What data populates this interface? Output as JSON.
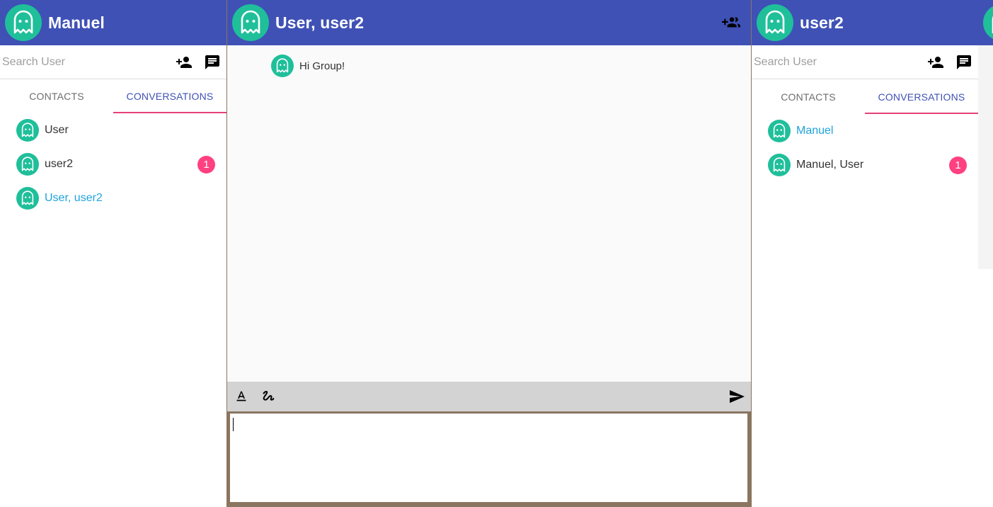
{
  "left": {
    "user_name": "Manuel",
    "search_placeholder": "Search User",
    "tabs": [
      "CONTACTS",
      "CONVERSATIONS"
    ],
    "active_tab": "CONVERSATIONS",
    "conversations": [
      {
        "name": "User",
        "badge": ""
      },
      {
        "name": "user2",
        "badge": "1"
      },
      {
        "name": "User, user2",
        "badge": "",
        "selected": true
      }
    ]
  },
  "chat": {
    "title": "User, user2",
    "messages": [
      {
        "text": "Hi Group!"
      }
    ],
    "compose_value": "",
    "toolbar_icons": [
      "format-text-icon",
      "draw-icon",
      "send-icon"
    ]
  },
  "right": {
    "user_name": "user2",
    "search_placeholder": "Search User",
    "tabs": [
      "CONTACTS",
      "CONVERSATIONS"
    ],
    "active_tab": "CONVERSATIONS",
    "conversations": [
      {
        "name": "Manuel",
        "badge": "",
        "selected": true
      },
      {
        "name": "Manuel, User",
        "badge": "1"
      }
    ]
  },
  "colors": {
    "header": "#3f51b5",
    "accent_tab_indicator": "#e5407a",
    "badge": "#ff4081",
    "selected_text": "#1fa3dc",
    "avatar": "#1fbf9a"
  }
}
